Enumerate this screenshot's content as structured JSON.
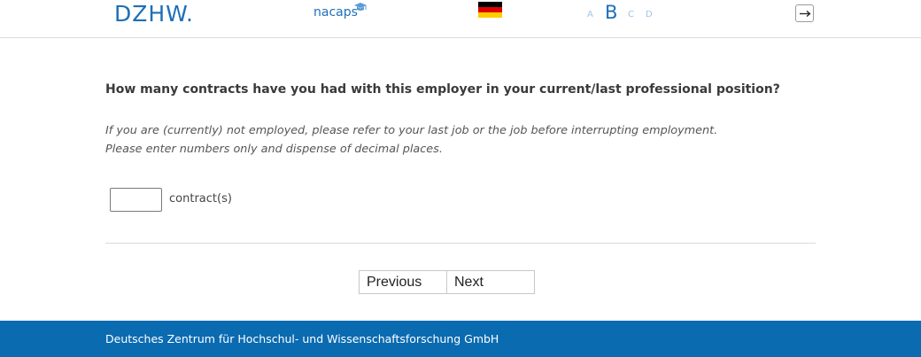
{
  "header": {
    "logo_dzhw": "DZHW.",
    "logo_nacaps": "nacaps",
    "language_flag": "german-flag-icon",
    "font_sizes": [
      "A",
      "B",
      "C",
      "D"
    ],
    "logout_icon": "logout-arrow-icon"
  },
  "question": {
    "text": "How many contracts have you had with this employer in your current/last professional position?",
    "hint_line1": "If you are (currently) not employed, please refer to your last job or the job before interrupting employment.",
    "hint_line2": "Please enter numbers only and dispense of decimal places.",
    "input_value": "",
    "unit": "contract(s)"
  },
  "navigation": {
    "previous_label": "Previous",
    "next_label": "Next"
  },
  "footer": {
    "text": "Deutsches Zentrum für Hochschul- und Wissenschaftsforschung GmbH"
  },
  "colors": {
    "brand_blue": "#1d6fb8",
    "footer_blue": "#0a6bb1",
    "flag_black": "#000000",
    "flag_red": "#dd0000",
    "flag_gold": "#ffce00"
  }
}
